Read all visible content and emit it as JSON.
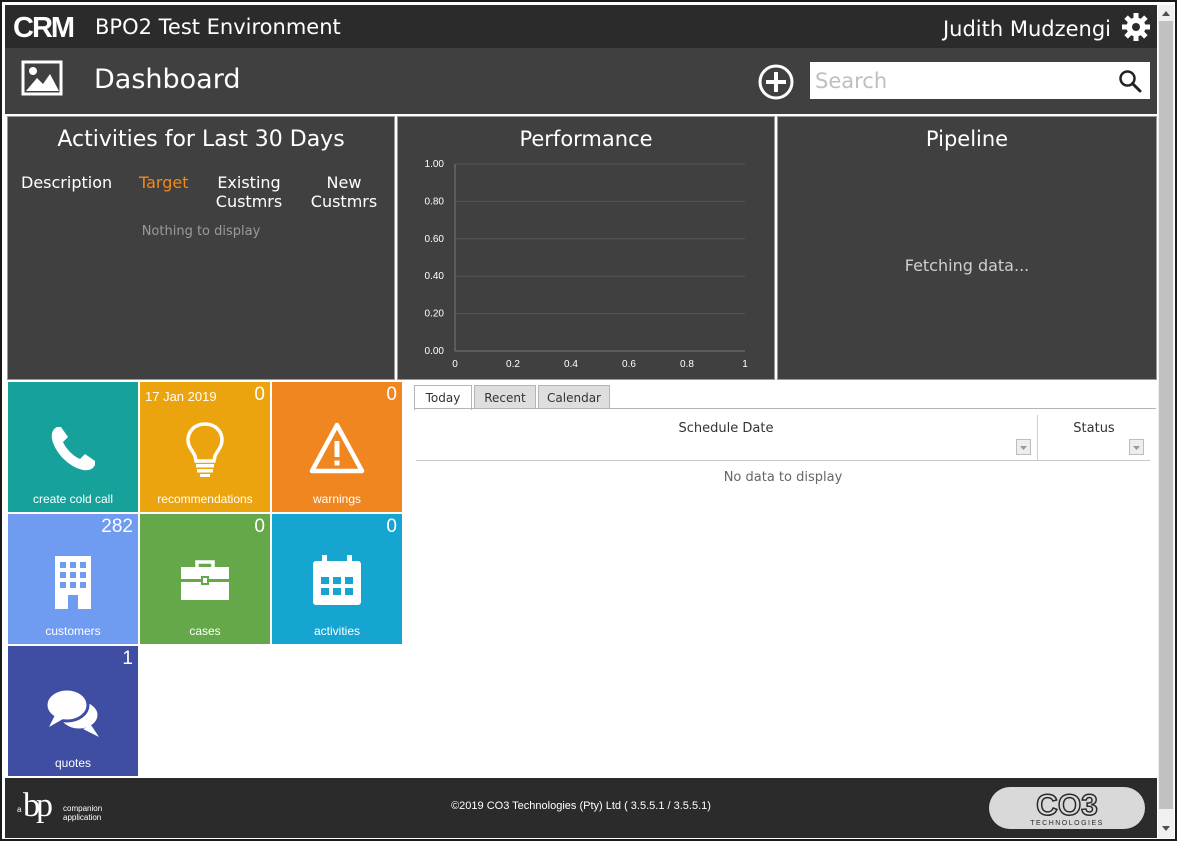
{
  "topbar": {
    "logo_text": "CRM",
    "env_title": "BPO2 Test Environment",
    "user_name": "Judith Mudzengi",
    "settings_icon": "gear-icon"
  },
  "header": {
    "page_icon": "image-icon",
    "page_title": "Dashboard",
    "add_icon": "plus-circle-icon",
    "search": {
      "placeholder": "Search",
      "value": "",
      "icon": "search-icon"
    }
  },
  "panels": {
    "activities": {
      "title": "Activities for Last 30 Days",
      "columns": [
        "Description",
        "Target",
        "Existing\nCustmrs",
        "New\nCustmrs"
      ],
      "empty_text": "Nothing to display",
      "accent_color": "#f08a1c"
    },
    "performance": {
      "title": "Performance",
      "chart_data": {
        "type": "line",
        "series": [],
        "xlim": [
          0,
          1
        ],
        "ylim": [
          0,
          1
        ],
        "x_ticks": [
          "0",
          "0.2",
          "0.4",
          "0.6",
          "0.8",
          "1"
        ],
        "y_ticks": [
          "1.00",
          "0.80",
          "0.60",
          "0.40",
          "0.20",
          "0.00"
        ],
        "grid": true
      }
    },
    "pipeline": {
      "title": "Pipeline",
      "status_text": "Fetching data..."
    }
  },
  "tiles": [
    {
      "label": "create cold call",
      "count": "",
      "date": "",
      "icon": "phone-icon",
      "color": "#16a29a"
    },
    {
      "label": "recommendations",
      "count": "0",
      "date": "17 Jan 2019",
      "icon": "lightbulb-icon",
      "color": "#eca40e"
    },
    {
      "label": "warnings",
      "count": "0",
      "date": "",
      "icon": "warning-icon",
      "color": "#f0861f"
    },
    {
      "label": "customers",
      "count": "282",
      "date": "",
      "icon": "building-icon",
      "color": "#6f9bf0"
    },
    {
      "label": "cases",
      "count": "0",
      "date": "",
      "icon": "briefcase-icon",
      "color": "#65a84a"
    },
    {
      "label": "activities",
      "count": "0",
      "date": "",
      "icon": "calendar-icon",
      "color": "#15a5d0"
    },
    {
      "label": "quotes",
      "count": "1",
      "date": "",
      "icon": "chat-bubbles-icon",
      "color": "#3f4da3"
    }
  ],
  "schedule": {
    "tabs": [
      "Today",
      "Recent",
      "Calendar"
    ],
    "active_tab": "Today",
    "columns": [
      "Schedule Date",
      "Status"
    ],
    "empty_text": "No data to display"
  },
  "footer": {
    "bp_logo": {
      "prefix": "a",
      "mark": "bp",
      "line1": "companion",
      "line2": "application"
    },
    "copyright": "©2019 CO3 Technologies (Pty) Ltd ( 3.5.5.1 / 3.5.5.1)",
    "co3_logo": {
      "mark": "CO3",
      "sub": "TECHNOLOGIES"
    }
  }
}
